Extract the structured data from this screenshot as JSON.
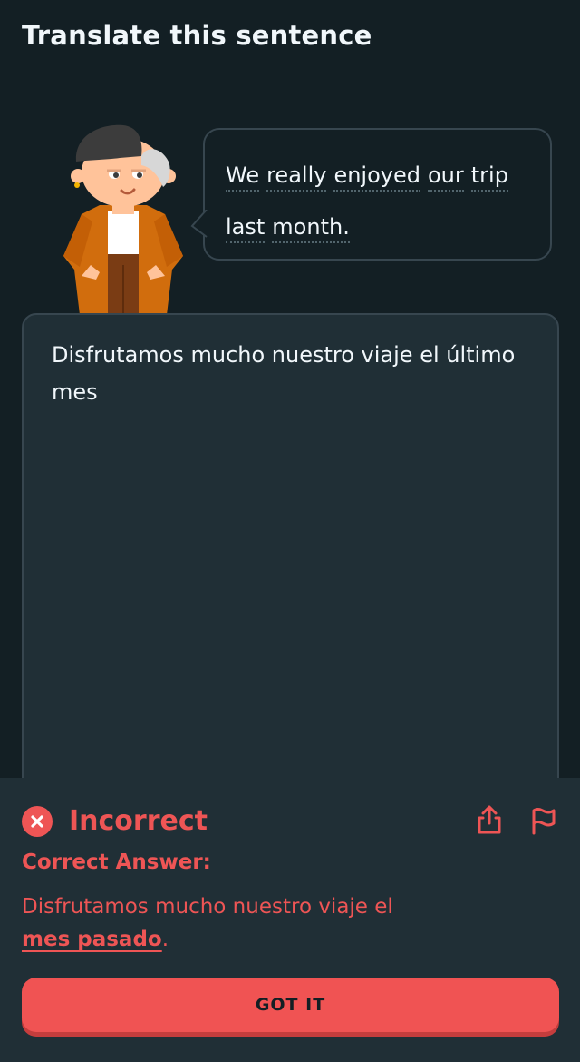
{
  "header": {
    "title": "Translate this sentence"
  },
  "prompt": {
    "character": "lin-character",
    "words": [
      "We",
      "really",
      "enjoyed",
      "our",
      "trip",
      "last",
      "month."
    ]
  },
  "answer": {
    "user_text": "Disfrutamos mucho nuestro viaje el último mes"
  },
  "feedback": {
    "status": "Incorrect",
    "status_icon": "x-icon",
    "correct_label": "Correct Answer:",
    "correct_prefix": "Disfrutamos mucho nuestro viaje el",
    "correct_highlight": "mes pasado",
    "correct_suffix": ".",
    "button_label": "GOT IT"
  },
  "colors": {
    "background": "#131f24",
    "panel": "#202f36",
    "border": "#37464f",
    "error": "#ee5555",
    "button": "#f05353"
  }
}
